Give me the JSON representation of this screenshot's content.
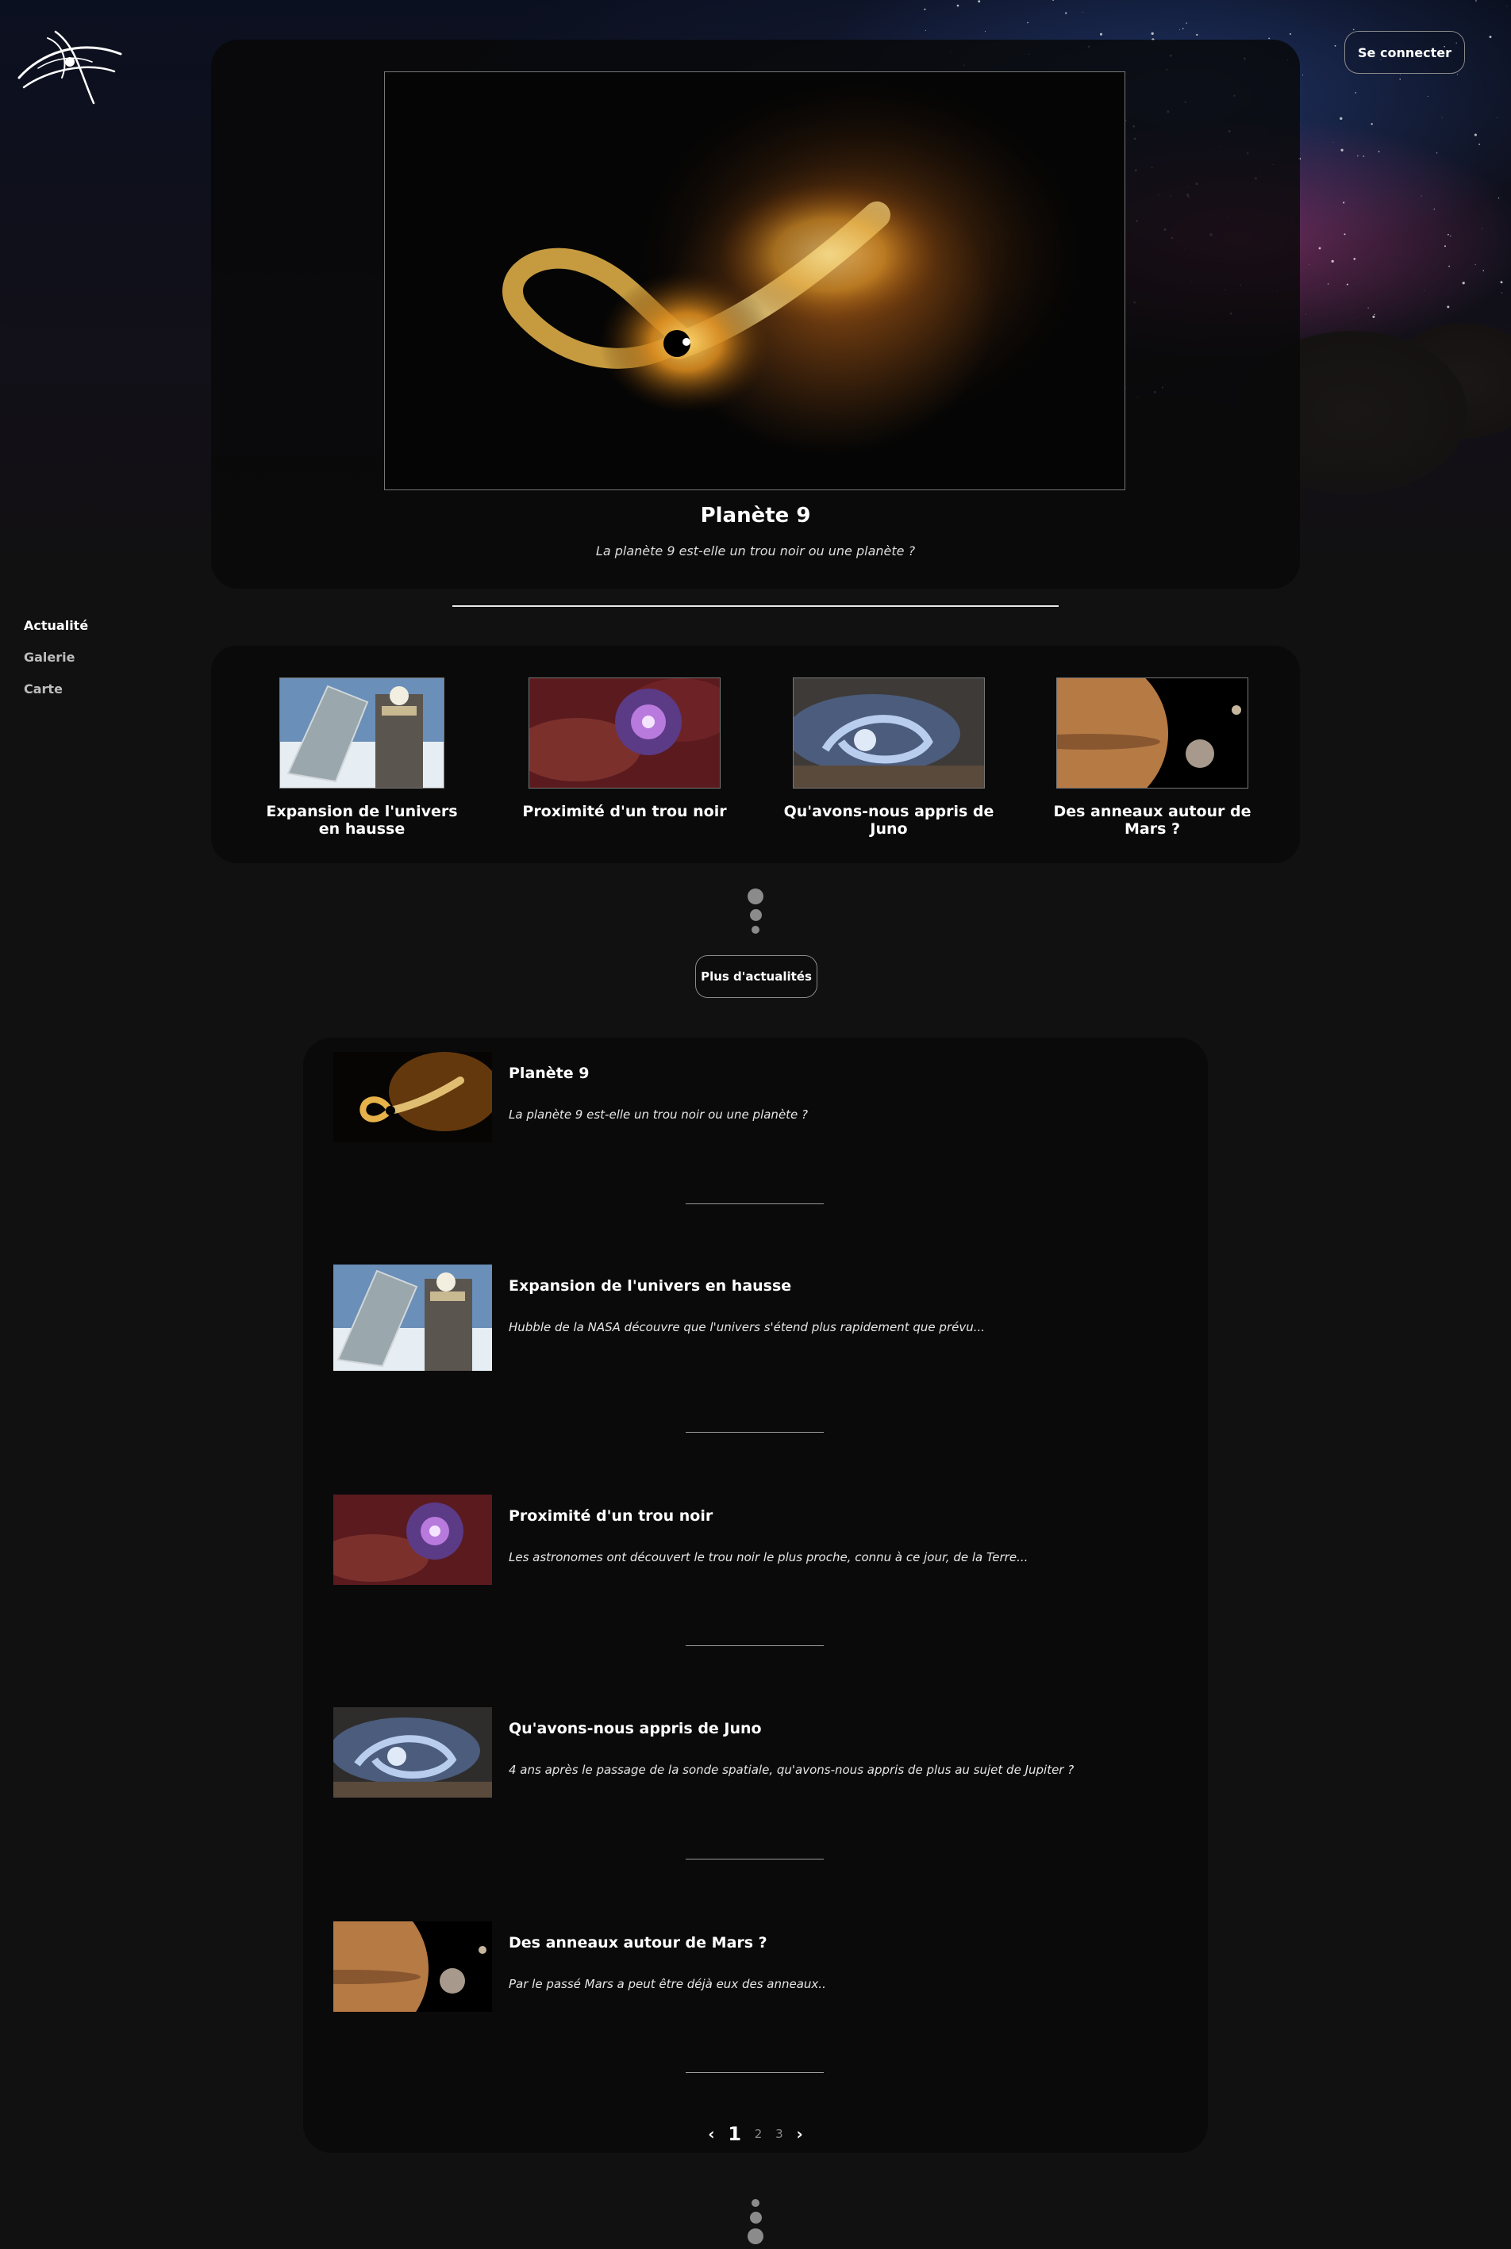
{
  "header": {
    "login_label": "Se connecter"
  },
  "nav": {
    "items": [
      {
        "label": "Actualité",
        "active": true
      },
      {
        "label": "Galerie",
        "active": false
      },
      {
        "label": "Carte",
        "active": false
      }
    ]
  },
  "hero": {
    "title": "Planète 9",
    "subtitle": "La planète 9 est-elle un trou noir ou une planète ?"
  },
  "strip": {
    "items": [
      {
        "title": "Expansion de l'univers en hausse",
        "image": "hubble-telescope"
      },
      {
        "title": "Proximité d'un trou noir",
        "image": "black-hole-nebula"
      },
      {
        "title": "Qu'avons-nous appris de Juno",
        "image": "jupiter-storm"
      },
      {
        "title": "Des anneaux autour de Mars ?",
        "image": "mars-and-moons"
      }
    ]
  },
  "more_label": "Plus d'actualités",
  "list": {
    "items": [
      {
        "title": "Planète 9",
        "desc": "La planète 9 est-elle un trou noir ou une planète ?",
        "image": "black-hole-jet"
      },
      {
        "title": "Expansion de l'univers en hausse",
        "desc": "Hubble de la NASA découvre que l'univers s'étend plus rapidement que prévu...",
        "image": "hubble-telescope"
      },
      {
        "title": "Proximité d'un trou noir",
        "desc": "Les astronomes ont découvert le trou noir le plus proche, connu à ce jour, de la Terre...",
        "image": "black-hole-nebula"
      },
      {
        "title": "Qu'avons-nous appris de Juno",
        "desc": "4 ans après le passage de la sonde spatiale, qu'avons-nous appris de plus au sujet de Jupiter ?",
        "image": "jupiter-storm"
      },
      {
        "title": "Des anneaux autour de Mars ?",
        "desc": "Par le passé Mars a peut être déjà eux des anneaux..",
        "image": "mars-and-moons"
      }
    ]
  },
  "pagination": {
    "prev": "‹",
    "pages": [
      "1",
      "2",
      "3"
    ],
    "current": "1",
    "next": "›"
  },
  "colors": {
    "background": "#111111",
    "card": "#0a0a0a",
    "accent_sky": "#b43c82"
  }
}
